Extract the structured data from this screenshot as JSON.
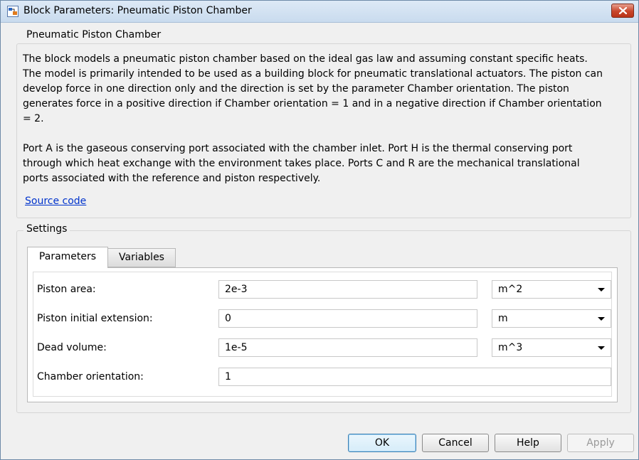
{
  "window": {
    "title": "Block Parameters: Pneumatic Piston Chamber"
  },
  "description_group": {
    "label": "Pneumatic Piston Chamber",
    "paragraph1_lines": [
      "The block models a pneumatic piston chamber based on the ideal gas law and assuming constant specific heats.",
      "The model is primarily intended to be used as a building block for pneumatic translational actuators. The piston can",
      "develop force in one direction only and the direction is set by the parameter Chamber orientation. The piston",
      "generates force in a positive direction if Chamber orientation = 1 and in a negative direction if Chamber orientation",
      "= 2."
    ],
    "paragraph2_lines": [
      "Port A is the gaseous conserving port associated with the chamber inlet. Port H is the thermal conserving port",
      "through which heat exchange with the environment takes place. Ports C and R are the mechanical translational",
      "ports associated with the reference and piston respectively."
    ],
    "link": "Source code"
  },
  "settings": {
    "label": "Settings",
    "tabs": [
      {
        "label": "Parameters",
        "active": true
      },
      {
        "label": "Variables",
        "active": false
      }
    ],
    "parameters": [
      {
        "label": "Piston area:",
        "value": "2e-3",
        "unit": "m^2"
      },
      {
        "label": "Piston initial extension:",
        "value": "0",
        "unit": "m"
      },
      {
        "label": "Dead volume:",
        "value": "1e-5",
        "unit": "m^3"
      },
      {
        "label": "Chamber orientation:",
        "value": "1"
      }
    ]
  },
  "buttons": {
    "ok": "OK",
    "cancel": "Cancel",
    "help": "Help",
    "apply": "Apply"
  },
  "colors": {
    "link": "#0033cc",
    "close_button": "#c8452a",
    "dialog_background": "#f0f0f0"
  }
}
